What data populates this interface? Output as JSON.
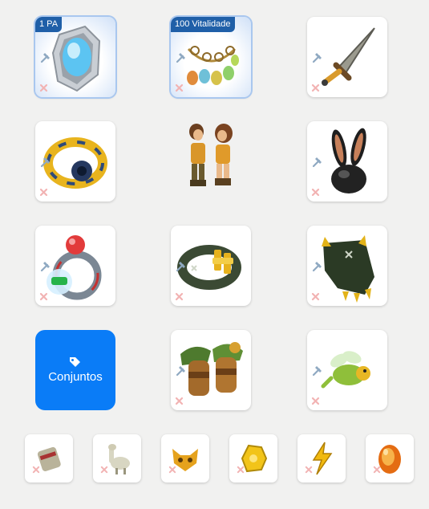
{
  "badges": {
    "first_slot": "1 PA",
    "second_slot": "100 Vitalidade"
  },
  "sets_button": {
    "label": "Conjuntos",
    "icon": "tags-icon"
  },
  "slots": [
    {
      "name": "shield-slot",
      "icon": "crystal-shield-item"
    },
    {
      "name": "amulet-slot",
      "icon": "egg-amulet-item"
    },
    {
      "name": "weapon-slot",
      "icon": "dagger-item"
    },
    {
      "name": "belt-slot",
      "icon": "golden-belt-item"
    },
    {
      "name": "hat-slot",
      "icon": "bunny-hat-item"
    },
    {
      "name": "ring-left-slot",
      "icon": "red-gem-ring-item"
    },
    {
      "name": "ring-right-slot",
      "icon": "green-gold-ring-item"
    },
    {
      "name": "cloak-slot",
      "icon": "green-claw-cloak-item"
    },
    {
      "name": "boots-slot",
      "icon": "leaf-boots-item"
    },
    {
      "name": "pet-slot",
      "icon": "winged-dragon-pet-item"
    },
    {
      "name": "dofus-slot-1",
      "icon": "scroll-item"
    },
    {
      "name": "dofus-slot-2",
      "icon": "llama-item"
    },
    {
      "name": "dofus-slot-3",
      "icon": "fox-mask-item"
    },
    {
      "name": "dofus-slot-4",
      "icon": "gold-nugget-item"
    },
    {
      "name": "dofus-slot-5",
      "icon": "lightning-item"
    },
    {
      "name": "dofus-slot-6",
      "icon": "amber-egg-item"
    }
  ],
  "colors": {
    "background": "#f1f1f0",
    "sets_button": "#0a7cf7",
    "badge": "#1f5fa8",
    "remove_icon": "#f2b3b3",
    "hammer_icon": "#8fa9c2"
  }
}
